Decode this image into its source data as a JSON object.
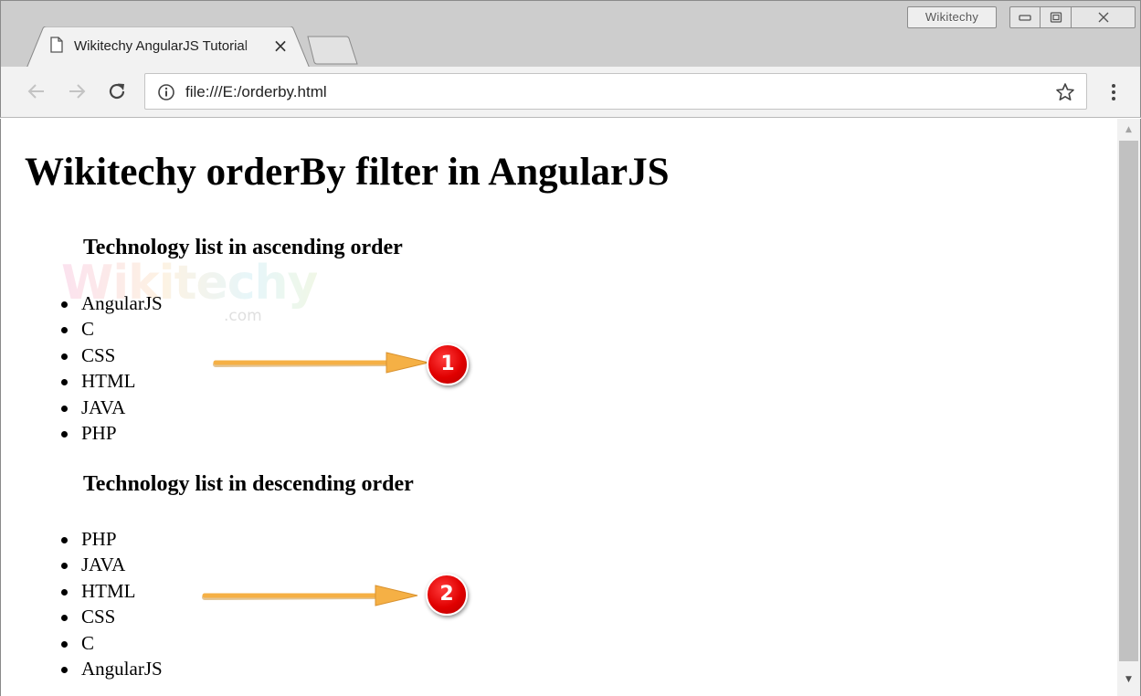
{
  "browser": {
    "profile_label": "Wikitechy",
    "tab_title": "Wikitechy AngularJS Tutorial",
    "url": "file:///E:/orderby.html"
  },
  "page": {
    "heading": "Wikitechy orderBy filter in AngularJS",
    "ascending": {
      "heading": "Technology list in ascending order",
      "items": [
        "AngularJS",
        "C",
        "CSS",
        "HTML",
        "JAVA",
        "PHP"
      ]
    },
    "descending": {
      "heading": "Technology list in descending order",
      "items": [
        "PHP",
        "JAVA",
        "HTML",
        "CSS",
        "C",
        "AngularJS"
      ]
    }
  },
  "watermark": {
    "text": "Wikitechy",
    "sub": ".com"
  },
  "annotations": [
    {
      "label": "1"
    },
    {
      "label": "2"
    }
  ],
  "colors": {
    "arrow": "#f5b045",
    "badge": "#e00000"
  }
}
